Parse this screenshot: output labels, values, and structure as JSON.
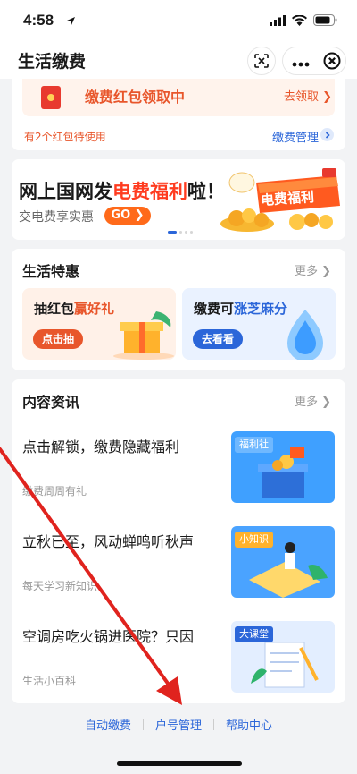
{
  "status": {
    "time": "4:58"
  },
  "nav": {
    "title": "生活缴费"
  },
  "redpacket": {
    "banner_text": "缴费红包领取中",
    "go_label": "去领取 ❯",
    "pending_text": "有2个红包待使用",
    "manage_label": "缴费管理"
  },
  "promo": {
    "title_a": "网上国网发",
    "title_hl": "电费福利",
    "title_b": "啦！",
    "subtitle": "交电费享实惠",
    "go_label": "GO ❯",
    "art_label": "电费福利",
    "slides": 4,
    "active_slide": 0
  },
  "deals": {
    "title": "生活特惠",
    "more_label": "更多 ❯",
    "items": [
      {
        "title_a": "抽红包",
        "title_hl": "赢好礼",
        "button": "点击抽",
        "accent": "#e8562b"
      },
      {
        "title_a": "缴费可",
        "title_hl": "涨芝麻分",
        "button": "去看看",
        "accent": "#2b66d9"
      }
    ]
  },
  "content": {
    "title": "内容资讯",
    "more_label": "更多 ❯",
    "articles": [
      {
        "title": "点击解锁，缴费隐藏福利",
        "source": "缴费周周有礼",
        "tag": "福利社"
      },
      {
        "title": "立秋已至，风动蝉鸣听秋声",
        "source": "每天学习新知识",
        "tag": "小知识"
      },
      {
        "title": "空调房吃火锅进医院？只因",
        "source": "生活小百科",
        "tag": "大课堂"
      }
    ]
  },
  "footer": {
    "links": [
      "自动缴费",
      "户号管理",
      "帮助中心"
    ]
  },
  "colors": {
    "accent_orange": "#e8562b",
    "accent_blue": "#2b66d9",
    "annotation_red": "#e0231e"
  },
  "icons": [
    "location-arrow-icon",
    "signal-icon",
    "wifi-icon",
    "battery-icon",
    "scan-icon",
    "more-icon",
    "close-icon",
    "chevron-right-icon"
  ]
}
